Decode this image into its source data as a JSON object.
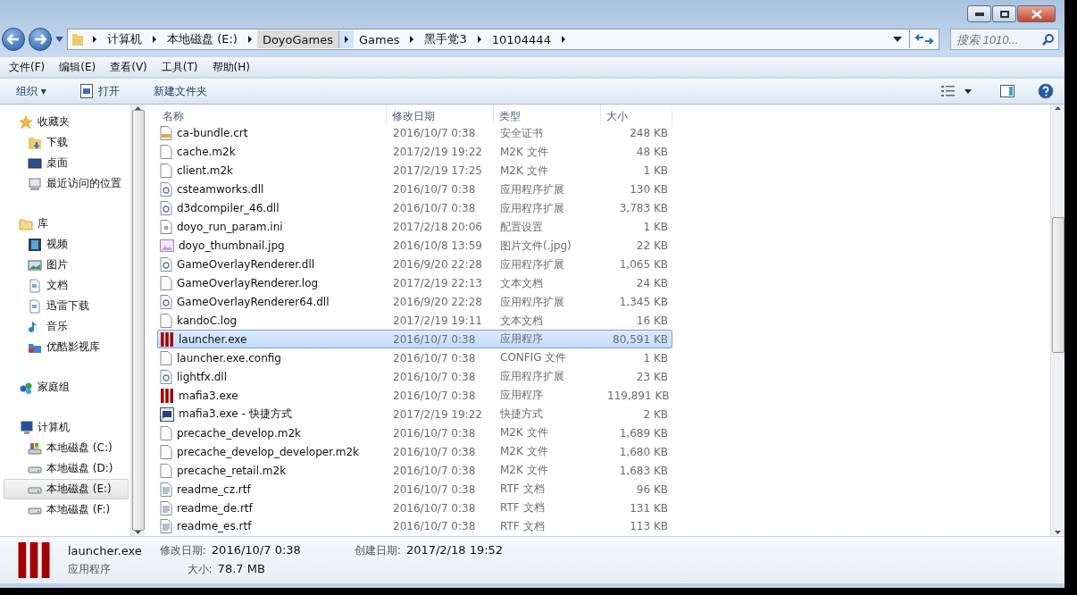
{
  "breadcrumbs": [
    {
      "label": "计算机",
      "selected": false
    },
    {
      "label": "本地磁盘 (E:)",
      "selected": false
    },
    {
      "label": "DoyoGames",
      "selected": true
    },
    {
      "label": "Games",
      "selected": false
    },
    {
      "label": "黑手党3",
      "selected": false
    },
    {
      "label": "10104444",
      "selected": false
    }
  ],
  "search": {
    "placeholder": "搜索 1010..."
  },
  "menu": [
    "文件(F)",
    "编辑(E)",
    "查看(V)",
    "工具(T)",
    "帮助(H)"
  ],
  "toolbar": {
    "organize": "组织 ▾",
    "open": "打开",
    "new_folder": "新建文件夹"
  },
  "sidebar": [
    {
      "label": "收藏夹",
      "kind": "star",
      "children": [
        {
          "label": "下载",
          "kind": "download",
          "selected": false
        },
        {
          "label": "桌面",
          "kind": "desktop",
          "selected": false
        },
        {
          "label": "最近访问的位置",
          "kind": "recent",
          "selected": false
        }
      ]
    },
    {
      "label": "库",
      "kind": "library",
      "children": [
        {
          "label": "视频",
          "kind": "video",
          "selected": false
        },
        {
          "label": "图片",
          "kind": "picture",
          "selected": false
        },
        {
          "label": "文档",
          "kind": "doc",
          "selected": false
        },
        {
          "label": "迅雷下载",
          "kind": "doc",
          "selected": false
        },
        {
          "label": "音乐",
          "kind": "music",
          "selected": false
        },
        {
          "label": "优酷影视库",
          "kind": "folder",
          "selected": false
        }
      ]
    },
    {
      "label": "家庭组",
      "kind": "homegroup"
    },
    {
      "label": "计算机",
      "kind": "computer",
      "children": [
        {
          "label": "本地磁盘 (C:)",
          "kind": "sysdrive",
          "selected": false
        },
        {
          "label": "本地磁盘 (D:)",
          "kind": "drive",
          "selected": false
        },
        {
          "label": "本地磁盘 (E:)",
          "kind": "drive",
          "selected": true
        },
        {
          "label": "本地磁盘 (F:)",
          "kind": "drive",
          "selected": false
        }
      ]
    }
  ],
  "columns": [
    "名称",
    "修改日期",
    "类型",
    "大小"
  ],
  "files": [
    {
      "name": "ca-bundle.crt",
      "date": "2016/10/7 0:38",
      "type": "安全证书",
      "size": "248 KB",
      "kind": "cert",
      "selected": false
    },
    {
      "name": "cache.m2k",
      "date": "2017/2/19 19:22",
      "type": "M2K 文件",
      "size": "48 KB",
      "kind": "file",
      "selected": false
    },
    {
      "name": "client.m2k",
      "date": "2017/2/19 17:25",
      "type": "M2K 文件",
      "size": "1 KB",
      "kind": "file",
      "selected": false
    },
    {
      "name": "csteamworks.dll",
      "date": "2016/10/7 0:38",
      "type": "应用程序扩展",
      "size": "130 KB",
      "kind": "dll",
      "selected": false
    },
    {
      "name": "d3dcompiler_46.dll",
      "date": "2016/10/7 0:38",
      "type": "应用程序扩展",
      "size": "3,783 KB",
      "kind": "dll",
      "selected": false
    },
    {
      "name": "doyo_run_param.ini",
      "date": "2017/2/18 20:06",
      "type": "配置设置",
      "size": "1 KB",
      "kind": "ini",
      "selected": false
    },
    {
      "name": "doyo_thumbnail.jpg",
      "date": "2016/10/8 13:59",
      "type": "图片文件(.jpg)",
      "size": "22 KB",
      "kind": "image",
      "selected": false
    },
    {
      "name": "GameOverlayRenderer.dll",
      "date": "2016/9/20 22:28",
      "type": "应用程序扩展",
      "size": "1,065 KB",
      "kind": "dll",
      "selected": false
    },
    {
      "name": "GameOverlayRenderer.log",
      "date": "2017/2/19 22:13",
      "type": "文本文档",
      "size": "24 KB",
      "kind": "file",
      "selected": false
    },
    {
      "name": "GameOverlayRenderer64.dll",
      "date": "2016/9/20 22:28",
      "type": "应用程序扩展",
      "size": "1,345 KB",
      "kind": "dll",
      "selected": false
    },
    {
      "name": "kandoC.log",
      "date": "2017/2/19 19:11",
      "type": "文本文档",
      "size": "16 KB",
      "kind": "file",
      "selected": false
    },
    {
      "name": "launcher.exe",
      "date": "2016/10/7 0:38",
      "type": "应用程序",
      "size": "80,591 KB",
      "kind": "app",
      "selected": true
    },
    {
      "name": "launcher.exe.config",
      "date": "2016/10/7 0:38",
      "type": "CONFIG 文件",
      "size": "1 KB",
      "kind": "file",
      "selected": false
    },
    {
      "name": "lightfx.dll",
      "date": "2016/10/7 0:38",
      "type": "应用程序扩展",
      "size": "23 KB",
      "kind": "dll",
      "selected": false
    },
    {
      "name": "mafia3.exe",
      "date": "2016/10/7 0:38",
      "type": "应用程序",
      "size": "119,891 KB",
      "kind": "app",
      "selected": false
    },
    {
      "name": "mafia3.exe - 快捷方式",
      "date": "2017/2/19 19:22",
      "type": "快捷方式",
      "size": "2 KB",
      "kind": "shortcut",
      "selected": false
    },
    {
      "name": "precache_develop.m2k",
      "date": "2016/10/7 0:38",
      "type": "M2K 文件",
      "size": "1,689 KB",
      "kind": "file",
      "selected": false
    },
    {
      "name": "precache_develop_developer.m2k",
      "date": "2016/10/7 0:38",
      "type": "M2K 文件",
      "size": "1,680 KB",
      "kind": "file",
      "selected": false
    },
    {
      "name": "precache_retail.m2k",
      "date": "2016/10/7 0:38",
      "type": "M2K 文件",
      "size": "1,683 KB",
      "kind": "file",
      "selected": false
    },
    {
      "name": "readme_cz.rtf",
      "date": "2016/10/7 0:38",
      "type": "RTF 文档",
      "size": "96 KB",
      "kind": "rtf",
      "selected": false
    },
    {
      "name": "readme_de.rtf",
      "date": "2016/10/7 0:38",
      "type": "RTF 文档",
      "size": "131 KB",
      "kind": "rtf",
      "selected": false
    },
    {
      "name": "readme_es.rtf",
      "date": "2016/10/7 0:38",
      "type": "RTF 文档",
      "size": "113 KB",
      "kind": "rtf",
      "selected": false
    }
  ],
  "details": {
    "name": "launcher.exe",
    "type": "应用程序",
    "fields": [
      {
        "label": "修改日期:",
        "value": "2016/10/7 0:38"
      },
      {
        "label": "大小:",
        "value": "78.7 MB"
      },
      {
        "label": "创建日期:",
        "value": "2017/2/18 19:52"
      }
    ]
  }
}
